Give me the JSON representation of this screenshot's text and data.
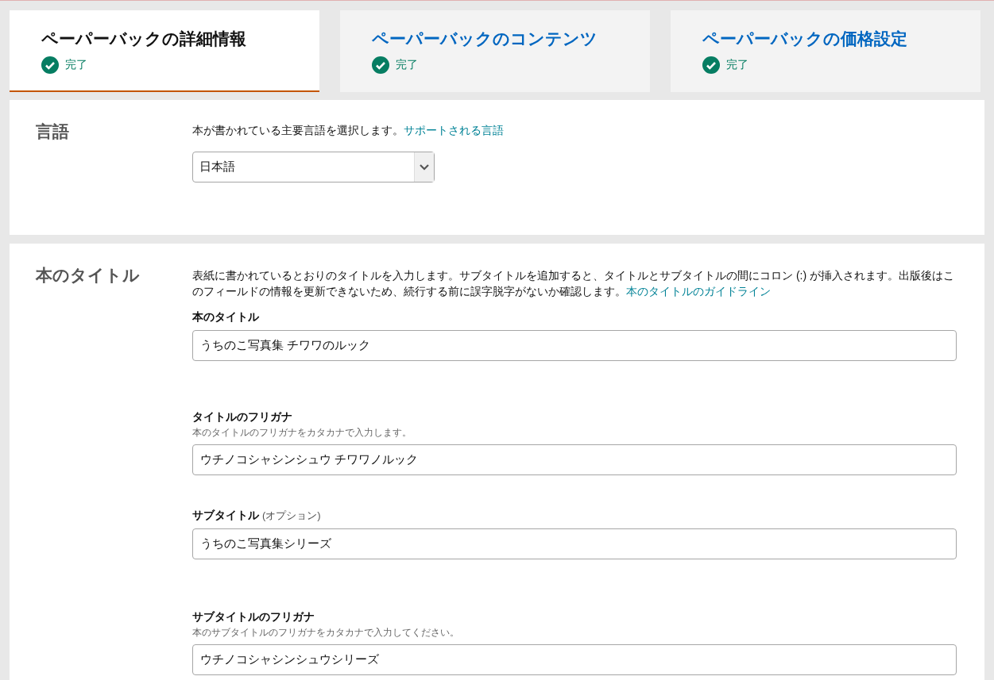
{
  "steps": [
    {
      "title": "ペーパーバックの詳細情報",
      "status": "完了",
      "selected": true
    },
    {
      "title": "ペーパーバックのコンテンツ",
      "status": "完了",
      "selected": false
    },
    {
      "title": "ペーパーバックの価格設定",
      "status": "完了",
      "selected": false
    }
  ],
  "language": {
    "heading": "言語",
    "description": "本が書かれている主要言語を選択します。",
    "link": "サポートされる言語",
    "select_value": "日本語"
  },
  "book_title": {
    "heading": "本のタイトル",
    "description": "表紙に書かれているとおりのタイトルを入力します。サブタイトルを追加すると、タイトルとサブタイトルの間にコロン (:) が挿入されます。出版後はこのフィールドの情報を更新できないため、続行する前に誤字脱字がないか確認します。",
    "link": "本のタイトルのガイドライン",
    "fields": [
      {
        "label": "本のタイトル",
        "value": "うちのこ写真集 チワワのルック"
      },
      {
        "label": "タイトルのフリガナ",
        "hint": "本のタイトルのフリガナをカタカナで入力します。",
        "value": "ウチノコシャシンシュウ チワワノルック"
      },
      {
        "label": "サブタイトル",
        "optional": "(オプション)",
        "value": "うちのこ写真集シリーズ"
      },
      {
        "label": "サブタイトルのフリガナ",
        "hint": "本のサブタイトルのフリガナをカタカナで入力してください。",
        "value": "ウチノコシャシンシュウシリーズ"
      }
    ]
  }
}
